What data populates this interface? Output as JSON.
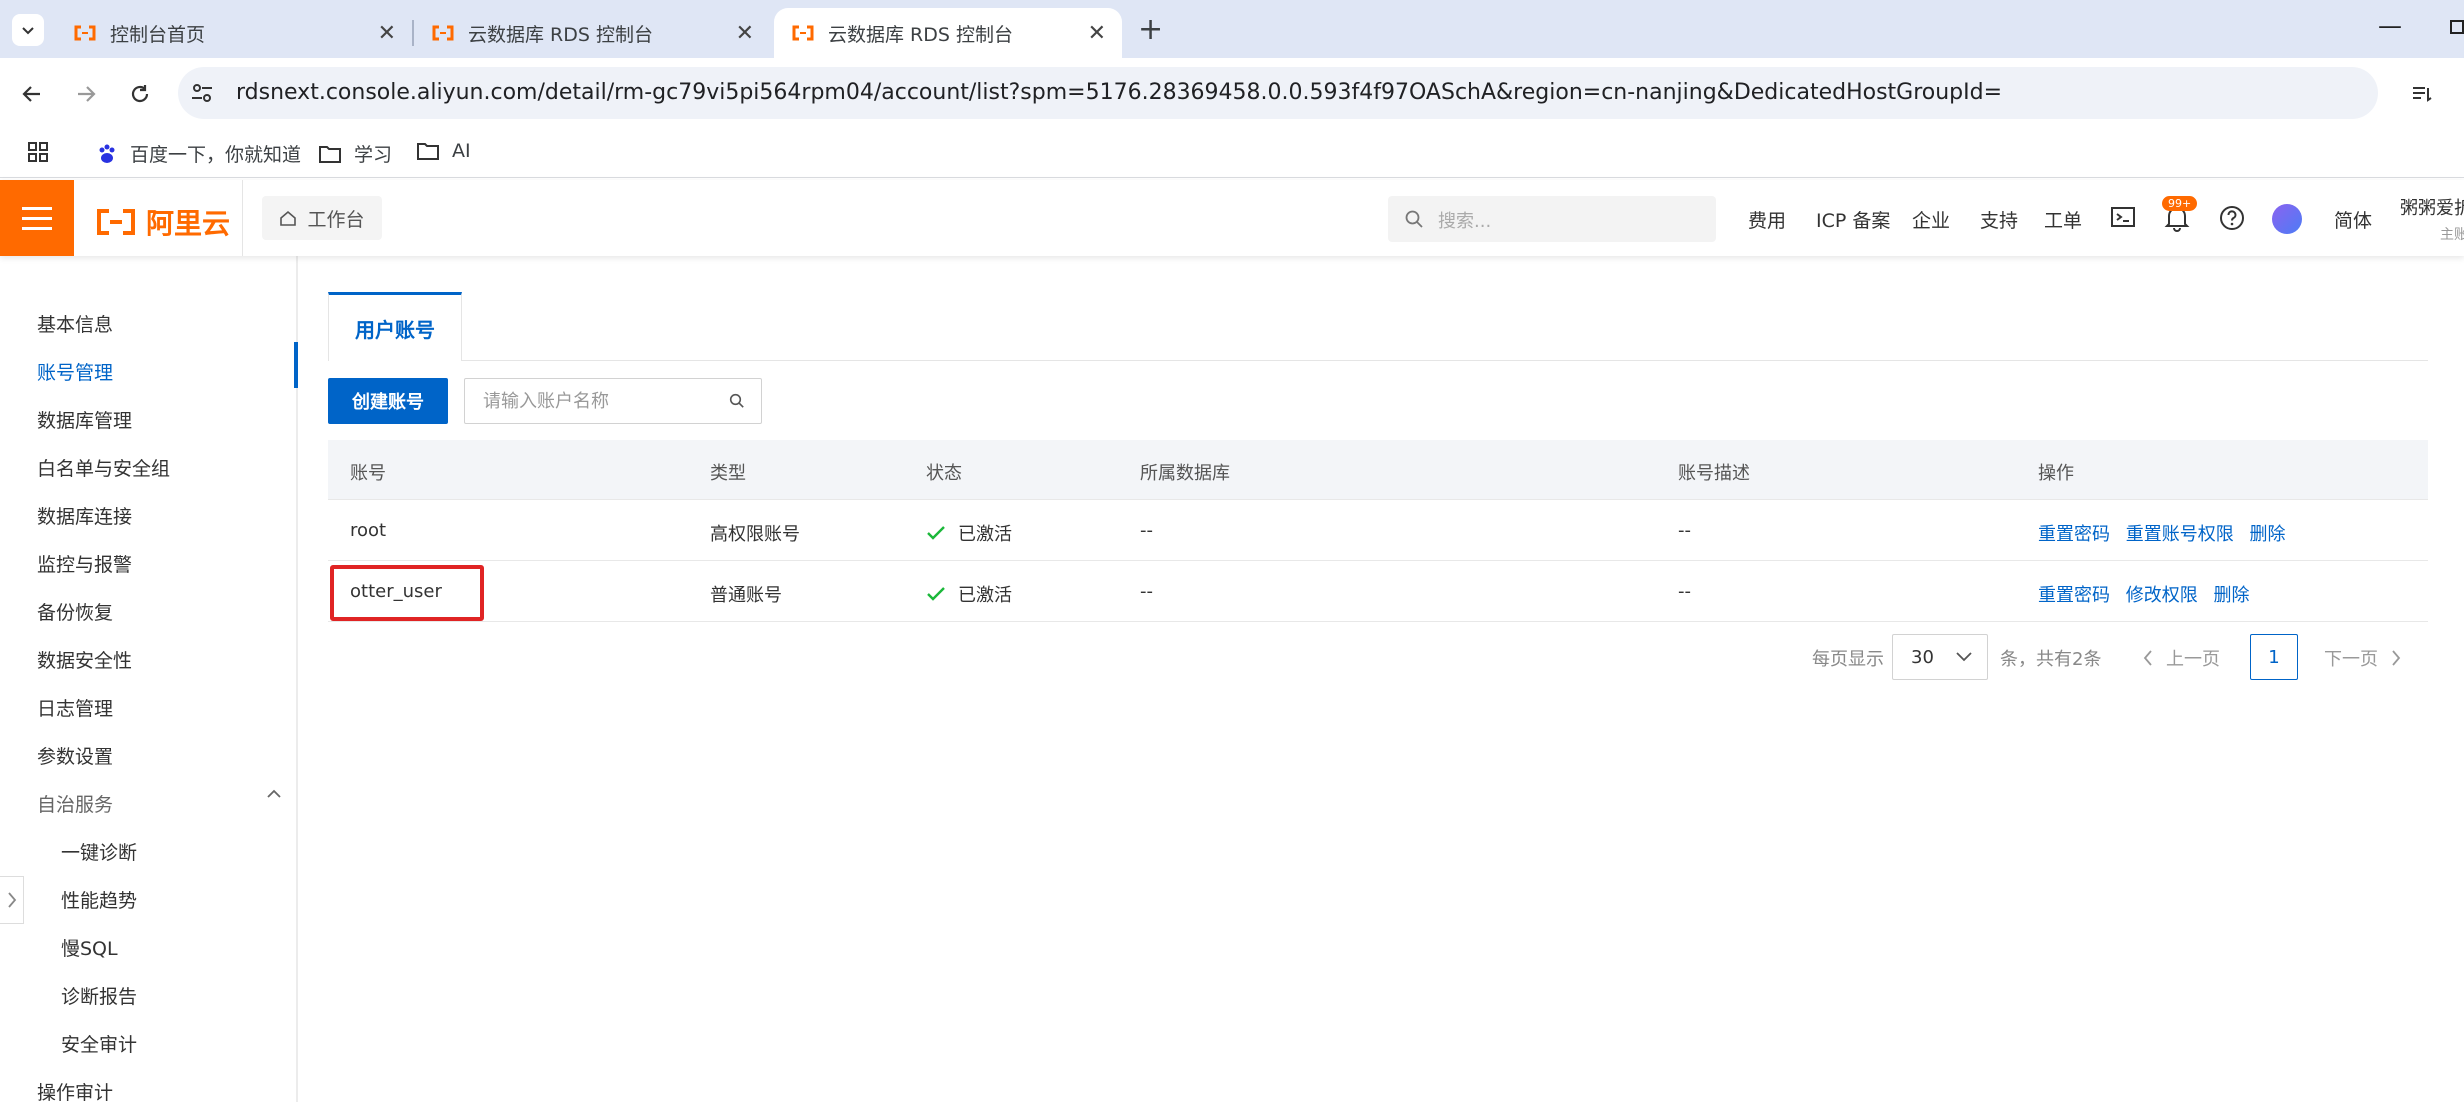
{
  "browser": {
    "tabs": [
      {
        "title": "控制台首页",
        "active": false
      },
      {
        "title": "云数据库 RDS 控制台",
        "active": false
      },
      {
        "title": "云数据库 RDS 控制台",
        "active": true
      }
    ],
    "url": "rdsnext.console.aliyun.com/detail/rm-gc79vi5pi564rpm04/account/list?spm=5176.28369458.0.0.593f4f97OASchA&region=cn-nanjing&DedicatedHostGroupId=",
    "bookmarks": [
      "百度一下，你就知道",
      "学习",
      "AI"
    ]
  },
  "topnav": {
    "logo_text": "阿里云",
    "workbench": "工作台",
    "search_placeholder": "搜索...",
    "links": [
      "费用",
      "ICP 备案",
      "企业",
      "支持",
      "工单"
    ],
    "notification_badge": "99+",
    "lang": "简体",
    "user_name": "粥粥爱折",
    "user_sub": "主账"
  },
  "sidebar": {
    "items": [
      {
        "label": "基本信息"
      },
      {
        "label": "账号管理",
        "active": true
      },
      {
        "label": "数据库管理"
      },
      {
        "label": "白名单与安全组"
      },
      {
        "label": "数据库连接"
      },
      {
        "label": "监控与报警"
      },
      {
        "label": "备份恢复"
      },
      {
        "label": "数据安全性"
      },
      {
        "label": "日志管理"
      },
      {
        "label": "参数设置"
      },
      {
        "label": "自治服务"
      }
    ],
    "sub_items": [
      "一键诊断",
      "性能趋势",
      "慢SQL",
      "诊断报告",
      "安全审计"
    ],
    "last_item": "操作审计"
  },
  "main": {
    "tab_label": "用户账号",
    "create_button": "创建账号",
    "search_placeholder": "请输入账户名称",
    "table": {
      "headers": [
        "账号",
        "类型",
        "状态",
        "所属数据库",
        "账号描述",
        "操作"
      ],
      "rows": [
        {
          "account": "root",
          "type": "高权限账号",
          "status": "已激活",
          "database": "--",
          "desc": "--",
          "ops": [
            "重置密码",
            "重置账号权限",
            "删除"
          ]
        },
        {
          "account": "otter_user",
          "type": "普通账号",
          "status": "已激活",
          "database": "--",
          "desc": "--",
          "ops": [
            "重置密码",
            "修改权限",
            "删除"
          ]
        }
      ]
    },
    "pagination": {
      "per_page_label": "每页显示",
      "per_page": "30",
      "total_text": "条，共有2条",
      "prev": "上一页",
      "current": "1",
      "next": "下一页"
    }
  },
  "colors": {
    "brand_orange": "#ff6a00",
    "primary_blue": "#0064c8",
    "highlight_red": "#e02424",
    "success_green": "#1bb83a"
  }
}
